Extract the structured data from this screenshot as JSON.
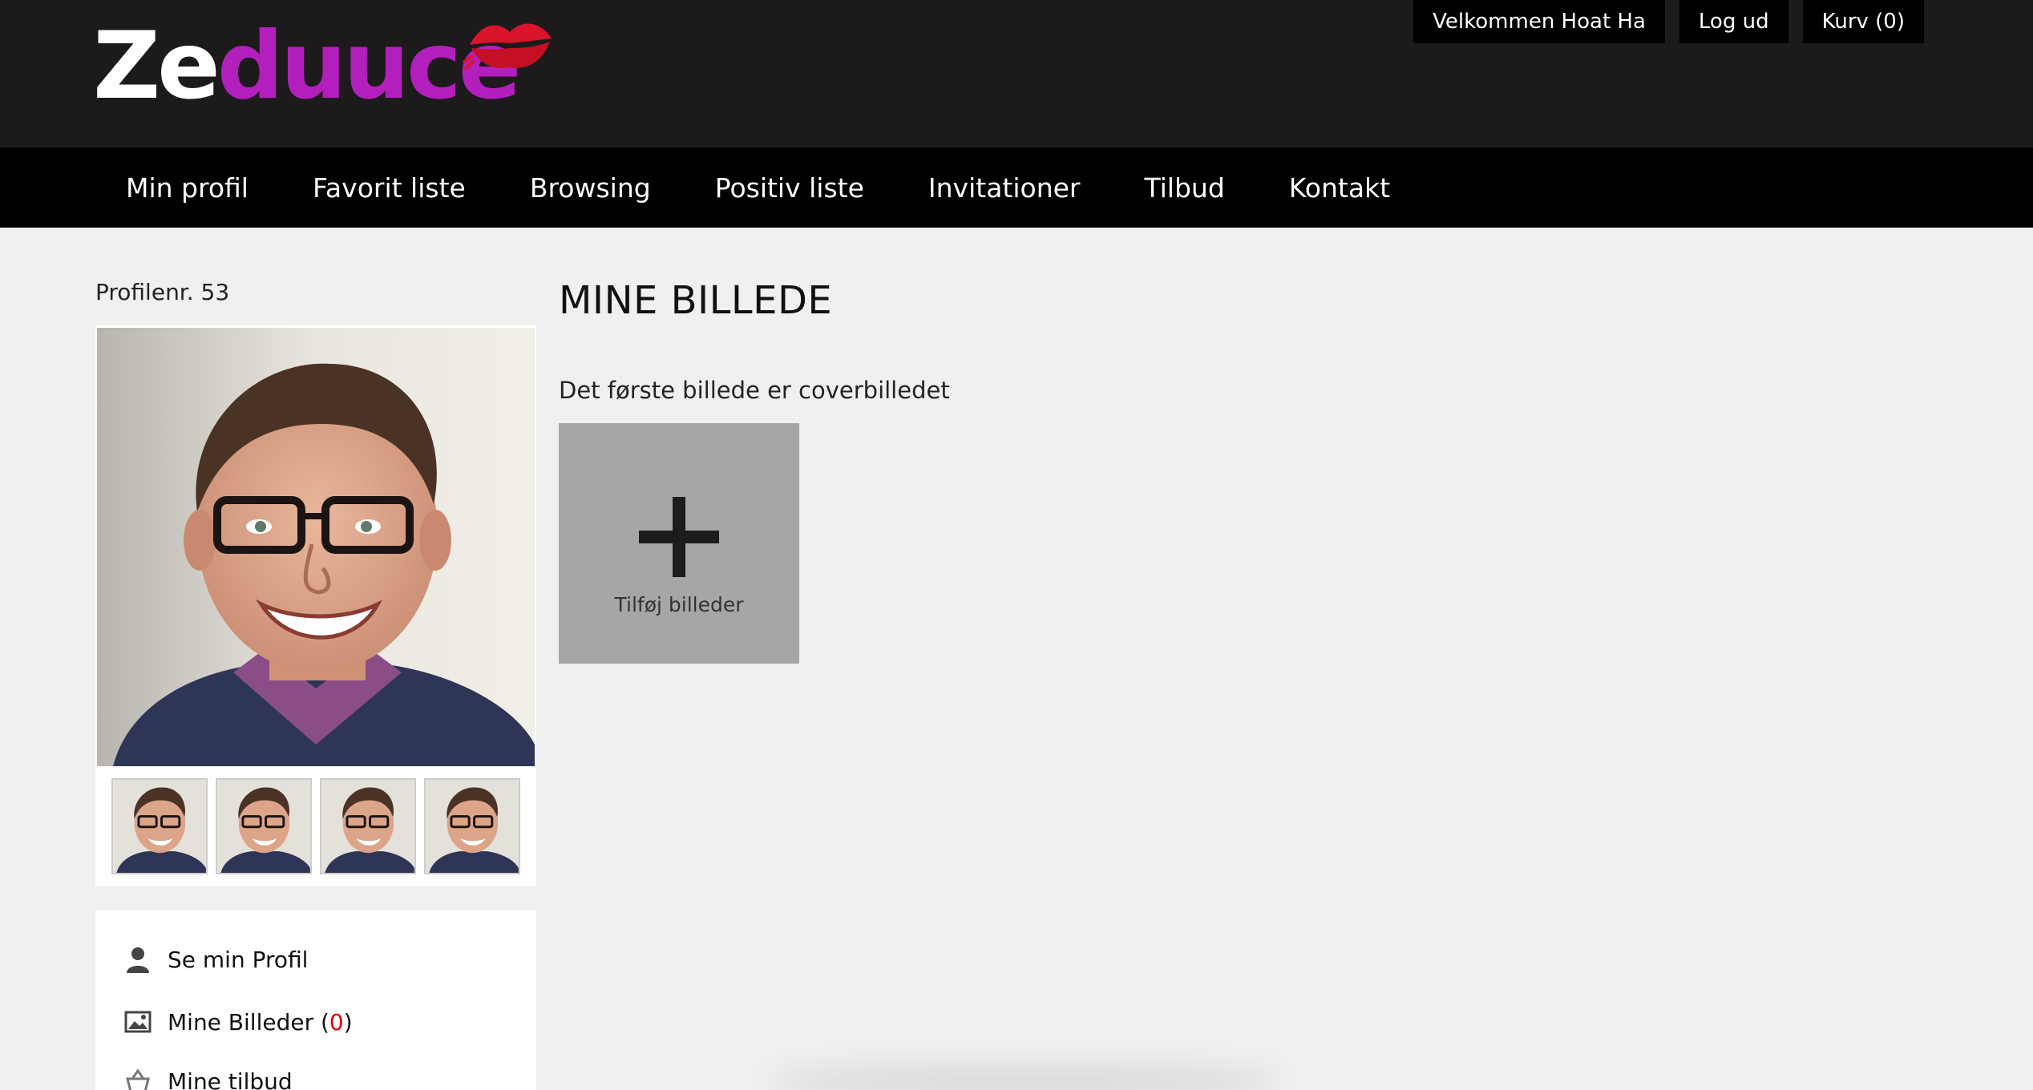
{
  "brand": {
    "logo_part1": "Ze",
    "logo_part2": "duuce",
    "white": "#ffffff",
    "purple": "#b31fbd",
    "lips_color": "#d9142b"
  },
  "header": {
    "welcome": "Velkommen Hoat Ha",
    "logout": "Log ud",
    "cart": "Kurv (0)"
  },
  "nav": {
    "items": [
      "Min profil",
      "Favorit liste",
      "Browsing",
      "Positiv liste",
      "Invitationer",
      "Tilbud",
      "Kontakt"
    ]
  },
  "profile": {
    "number_label": "Profilenr. 53",
    "photo_icon": "profile-photo",
    "thumbnail_count": 4
  },
  "side_menu": {
    "view_profile": "Se min Profil",
    "my_photos": "Mine Billeder (",
    "my_photos_count": "0",
    "my_photos_close": ")",
    "my_offers": "Mine tilbud"
  },
  "main": {
    "title": "MINE BILLEDE",
    "subtitle": "Det første billede er coverbilledet",
    "add_label": "Tilføj billeder",
    "add_icon": "plus-icon"
  }
}
